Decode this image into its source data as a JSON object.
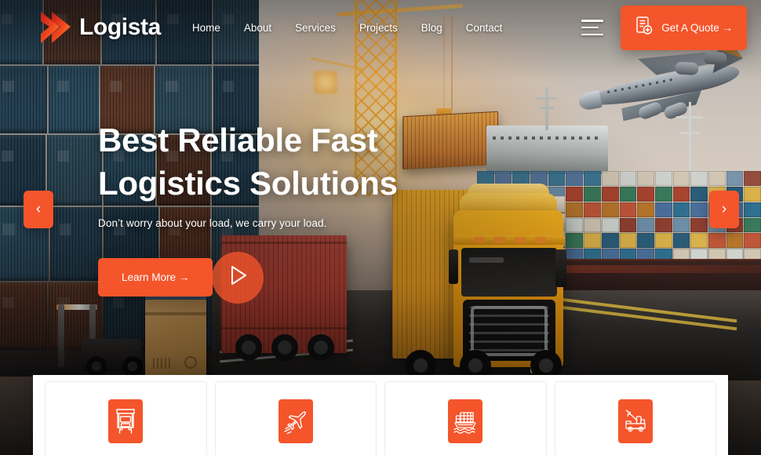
{
  "brand": {
    "name": "Logista",
    "logo_icon": "double-chevron-logo"
  },
  "nav": {
    "items": [
      {
        "label": "Home",
        "active": true
      },
      {
        "label": "About",
        "active": false
      },
      {
        "label": "Services",
        "active": false
      },
      {
        "label": "Projects",
        "active": false
      },
      {
        "label": "Blog",
        "active": false
      },
      {
        "label": "Contact",
        "active": false
      }
    ],
    "menu_icon": "hamburger-menu-icon"
  },
  "header": {
    "quote_button": {
      "label": "Get A Quote →",
      "icon": "document-add-icon"
    }
  },
  "hero": {
    "title_line1": "Best Reliable Fast",
    "title_line2": "Logistics Solutions",
    "subtitle": "Don’t worry about your load, we carry your load.",
    "cta_label": "Learn More →",
    "play_icon": "play-triangle-icon",
    "prev_arrow": "‹",
    "next_arrow": "›"
  },
  "services": {
    "cards": [
      {
        "icon": "truck-front-icon"
      },
      {
        "icon": "airplane-icon"
      },
      {
        "icon": "cargo-ship-icon"
      },
      {
        "icon": "crane-truck-icon"
      }
    ]
  },
  "colors": {
    "accent": "#F4552B",
    "accent_dark": "#D8411C",
    "logo_gradient_start": "#C21B1B",
    "logo_gradient_end": "#FF8A2B",
    "text_light": "#FFFFFF",
    "card_bg": "#FFFFFF",
    "card_border": "#EBEBEB"
  }
}
